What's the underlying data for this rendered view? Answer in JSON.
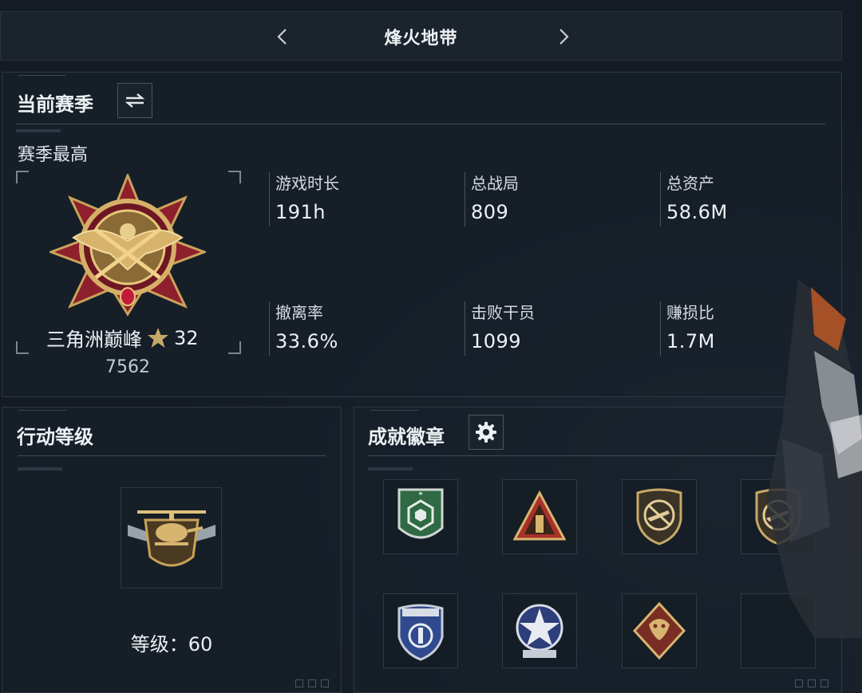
{
  "header": {
    "title": "烽火地带"
  },
  "season": {
    "title": "当前赛季",
    "subtitle": "赛季最高",
    "rank_name": "三角洲巅峰",
    "rank_stars": "32",
    "rank_score": "7562",
    "stats": [
      {
        "label": "游戏时长",
        "value": "191h"
      },
      {
        "label": "总战局",
        "value": "809"
      },
      {
        "label": "总资产",
        "value": "58.6M"
      },
      {
        "label": "撤离率",
        "value": "33.6%"
      },
      {
        "label": "击败干员",
        "value": "1099"
      },
      {
        "label": "赚损比",
        "value": "1.7M"
      }
    ]
  },
  "action_level": {
    "title": "行动等级",
    "level_text": "等级：60"
  },
  "achievements": {
    "title": "成就徽章",
    "badges": [
      {
        "icon": "green-hexagon-badge-icon",
        "color": "#3f7d56"
      },
      {
        "icon": "red-triangle-badge-icon",
        "color": "#a8312a"
      },
      {
        "icon": "no-rifle-shield-badge-icon",
        "color": "#8d7a52"
      },
      {
        "icon": "no-rifle-shield-badge-icon",
        "color": "#8d7a52"
      },
      {
        "icon": "blue-shield-badge-icon",
        "color": "#2f4a8f"
      },
      {
        "icon": "blue-star-emblem-icon",
        "color": "#2d3f7a"
      },
      {
        "icon": "dragon-diamond-badge-icon",
        "color": "#7a2d25"
      },
      {
        "icon": "empty-slot",
        "color": ""
      }
    ]
  },
  "colors": {
    "gold": "#c9a35a",
    "crimson": "#8e1f2c",
    "panel_border": "#2d3743"
  }
}
